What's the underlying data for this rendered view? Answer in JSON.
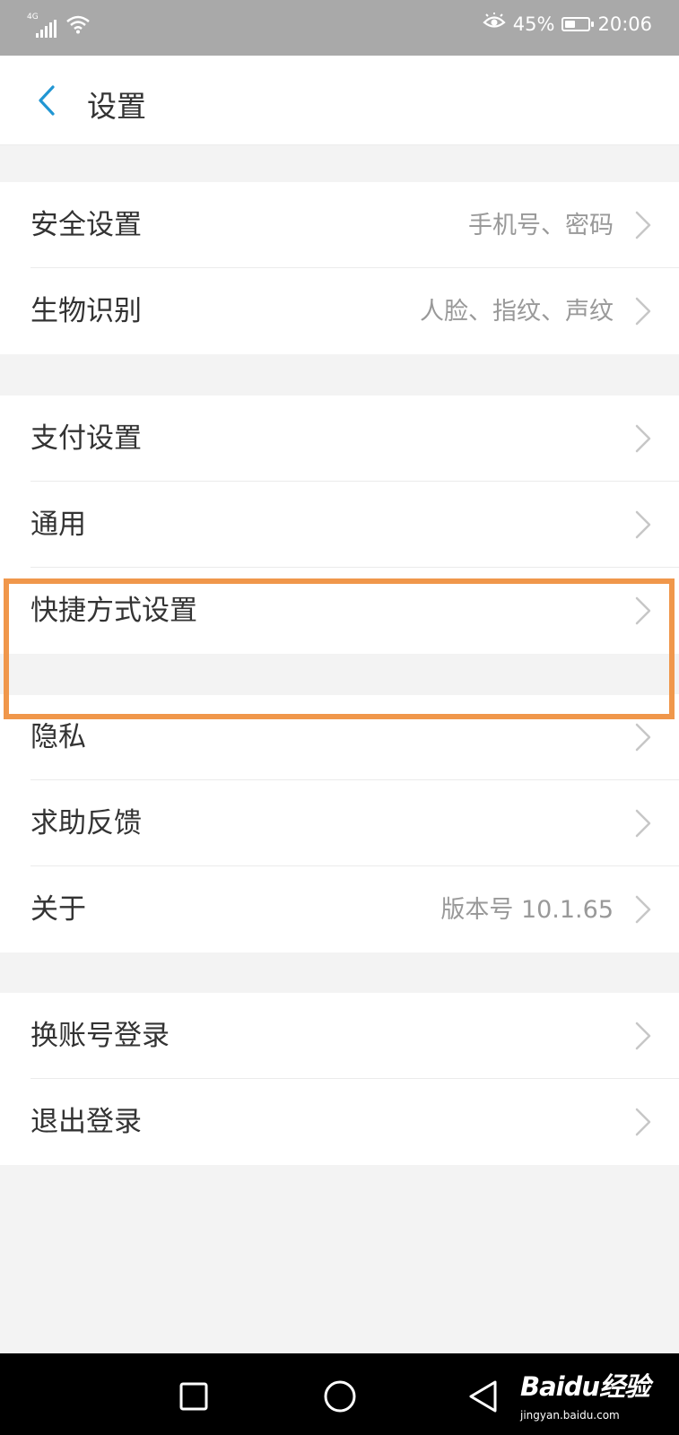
{
  "status_bar": {
    "network": "4G",
    "battery_text": "45%",
    "battery_level": 0.45,
    "time": "20:06",
    "icons": [
      "signal-icon",
      "wifi-icon",
      "eye-comfort-icon",
      "battery-icon"
    ]
  },
  "header": {
    "back_icon": "chevron-left-icon",
    "title": "设置"
  },
  "sections": [
    {
      "items": [
        {
          "label": "安全设置",
          "value": "手机号、密码"
        },
        {
          "label": "生物识别",
          "value": "人脸、指纹、声纹"
        }
      ]
    },
    {
      "items": [
        {
          "label": "支付设置",
          "value": ""
        },
        {
          "label": "通用",
          "value": ""
        },
        {
          "label": "快捷方式设置",
          "value": ""
        }
      ]
    },
    {
      "items": [
        {
          "label": "隐私",
          "value": ""
        },
        {
          "label": "求助反馈",
          "value": ""
        },
        {
          "label": "关于",
          "value": "版本号 10.1.65"
        }
      ]
    },
    {
      "items": [
        {
          "label": "换账号登录",
          "value": ""
        },
        {
          "label": "退出登录",
          "value": ""
        }
      ]
    }
  ],
  "nav_bar": {
    "buttons": [
      "recent-apps-icon",
      "home-icon",
      "back-icon"
    ]
  },
  "watermark": {
    "brand": "Baidu经验",
    "url": "jingyan.baidu.com"
  },
  "colors": {
    "accent": "#2196d3",
    "highlight": "#f0974b",
    "status_bar_bg": "#a9a9a9",
    "page_bg": "#f3f3f3"
  }
}
